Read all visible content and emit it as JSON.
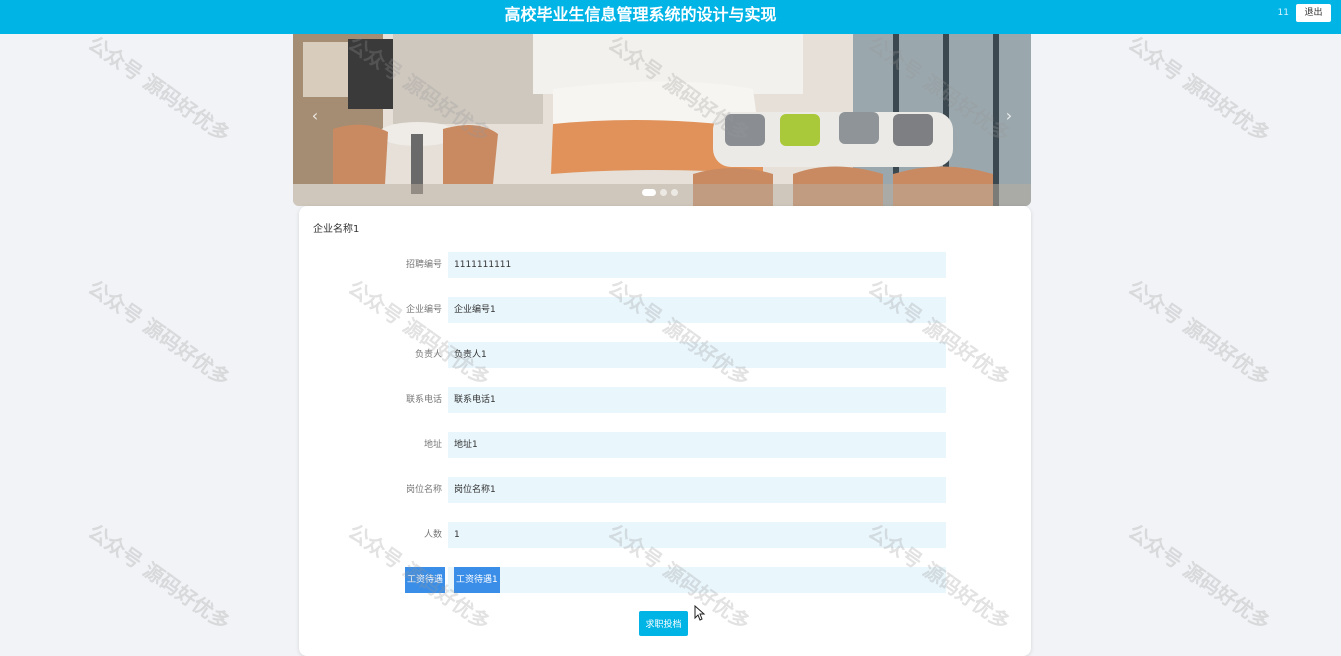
{
  "header": {
    "title": "高校毕业生信息管理系统的设计与实现",
    "user": "11",
    "logout_label": "退出"
  },
  "banner": {
    "prev_label": "‹",
    "next_label": "›",
    "slide_count": 3,
    "active_slide": 1
  },
  "detail": {
    "company_name": "企业名称1",
    "fields": [
      {
        "label": "招聘编号",
        "value": "1111111111"
      },
      {
        "label": "企业编号",
        "value": "企业编号1"
      },
      {
        "label": "负责人",
        "value": "负责人1"
      },
      {
        "label": "联系电话",
        "value": "联系电话1"
      },
      {
        "label": "地址",
        "value": "地址1"
      },
      {
        "label": "岗位名称",
        "value": "岗位名称1"
      },
      {
        "label": "人数",
        "value": "1"
      },
      {
        "label": "工资待遇",
        "value": "工资待遇1"
      }
    ],
    "apply_label": "求职投档"
  },
  "watermark": "公众号 源码好优多",
  "colors": {
    "accent": "#00b4e6",
    "field_bg": "#e9f6fc",
    "selection": "#3a8ee8"
  }
}
